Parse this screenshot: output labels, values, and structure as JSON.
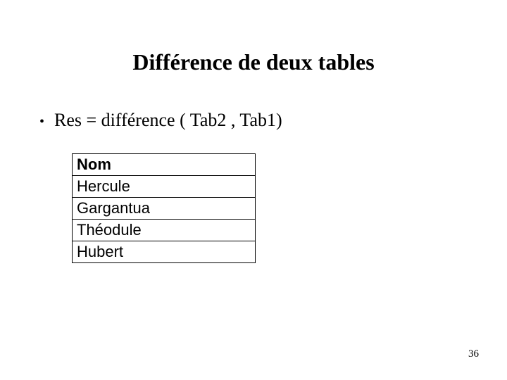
{
  "title": "Différence de deux tables",
  "bullet": {
    "marker": "•",
    "text": "Res = différence ( Tab2 , Tab1)"
  },
  "table": {
    "header": "Nom",
    "rows": [
      "Hercule",
      "Gargantua",
      "Théodule",
      "Hubert"
    ]
  },
  "page_number": "36"
}
